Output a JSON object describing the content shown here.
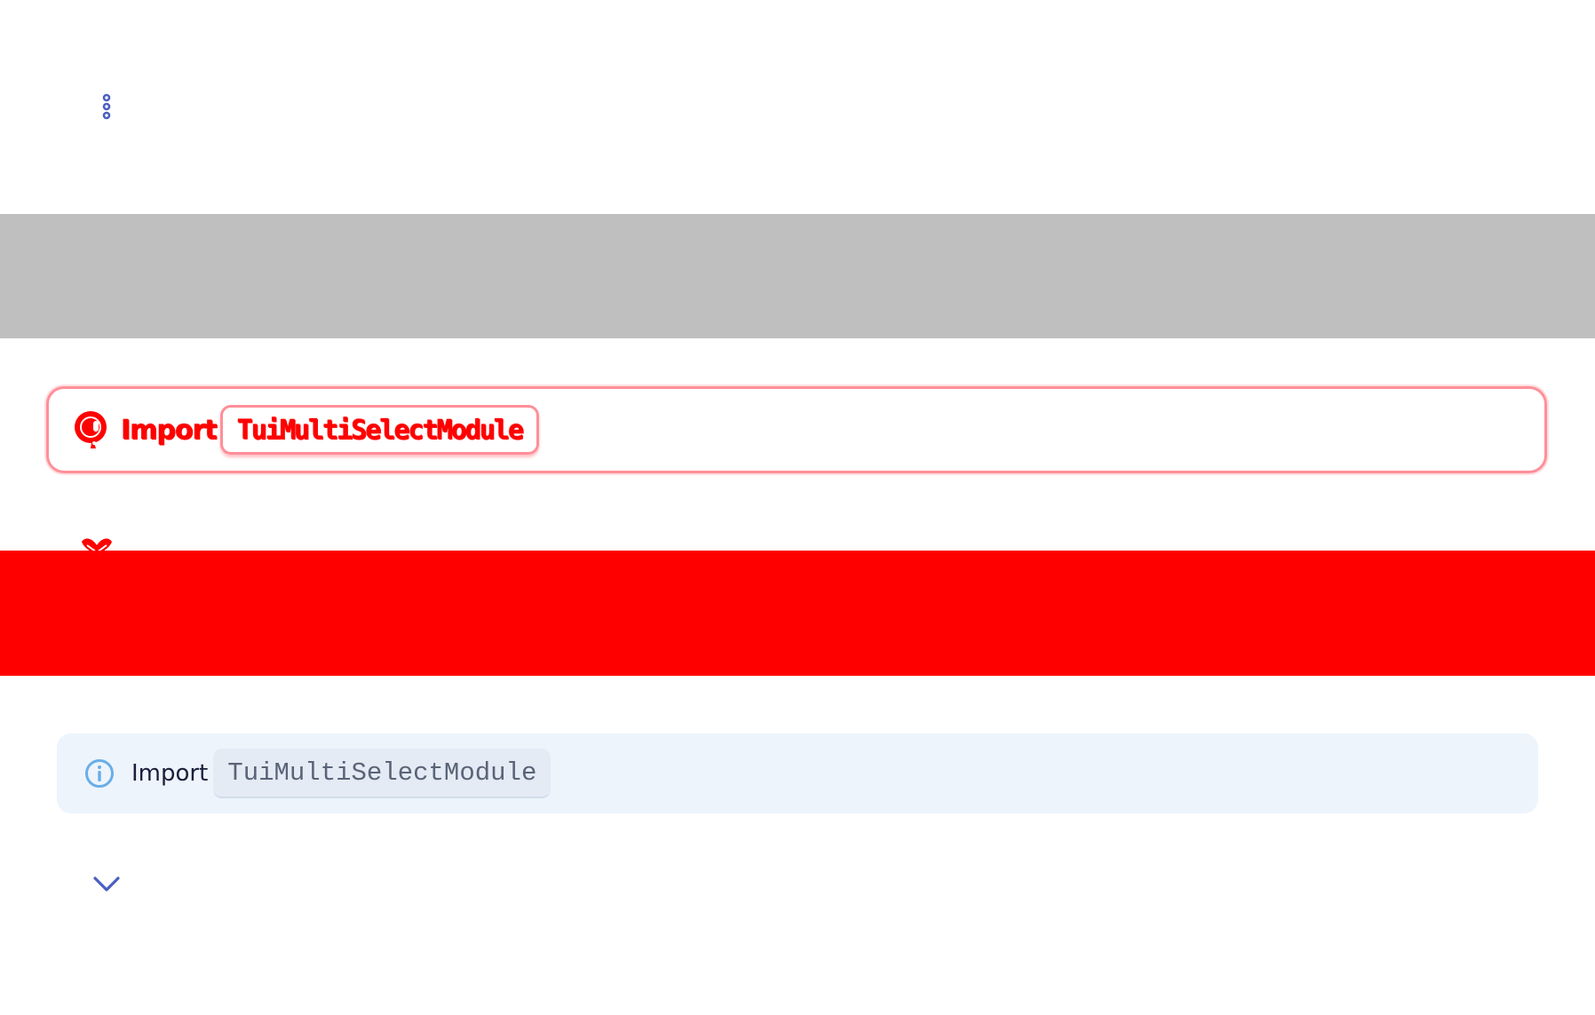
{
  "top_card": {
    "more_icon": "kebab-vertical-icon"
  },
  "highlighted_alert": {
    "icon": "info-icon",
    "label": "Import",
    "code": "TuiMultiSelectModule",
    "color": "#ff0000"
  },
  "red_chevron": {
    "icon": "chevron-down-icon",
    "color": "#ff0000"
  },
  "notice": {
    "icon": "info-circle-icon",
    "label": "Import",
    "code": "TuiMultiSelectModule",
    "background": "#edf4fc",
    "icon_color": "#6aaee8"
  },
  "expand": {
    "icon": "chevron-down-icon",
    "color": "#4a5fc1"
  },
  "colors": {
    "gray_band": "#bfbfbf",
    "red_band": "#ff0000",
    "accent": "#4a5fc1"
  }
}
